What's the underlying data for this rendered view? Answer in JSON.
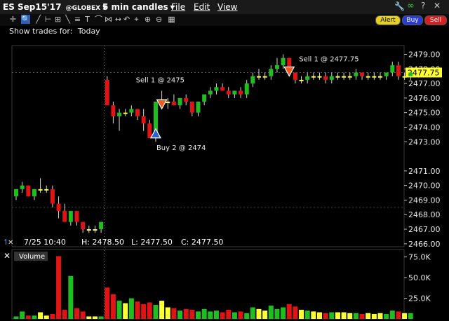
{
  "window": {
    "symbol": "ES Sep15'17",
    "exchange": "@GLOBEX",
    "interval": "5 min candles",
    "menus": [
      "File",
      "Edit",
      "View"
    ],
    "buttons": {
      "alert": "Alert",
      "buy": "Buy",
      "sell": "Sell"
    }
  },
  "toolbar": {
    "show_trades_label": "Show trades for:",
    "show_trades_value": "Today",
    "icons": [
      "crosshair-icon",
      "zoom-icon",
      "draw-tool-icon",
      "draw-tool-icon",
      "draw-tool-icon",
      "draw-tool-icon",
      "draw-tool-icon",
      "draw-tool-icon",
      "undo-icon",
      "draw-tool-icon",
      "draw-tool-icon",
      "zoom-in-icon",
      "zoom-out-icon",
      "draw-tool-icon",
      "layout-icon"
    ]
  },
  "colors": {
    "up": "#1fbe1f",
    "down": "#e01414",
    "neutral": "#ffff33",
    "price_box": "#ffff33",
    "background": "#000000"
  },
  "chart_data": {
    "type": "candlestick",
    "ylim": [
      2465.8,
      2479.6
    ],
    "yticks": [
      "2479.00",
      "2478.00",
      "2477.00",
      "2476.00",
      "2475.00",
      "2474.00",
      "2473.00",
      "2471.00",
      "2470.00",
      "2469.00",
      "2468.00",
      "2467.00",
      "2466.00"
    ],
    "ytick_values": [
      2479,
      2478,
      2477,
      2476,
      2475,
      2474,
      2473,
      2471,
      2470,
      2469,
      2468,
      2467,
      2466
    ],
    "last_price": "2477.75",
    "candles": [
      [
        2469.25,
        2469.75,
        2469.0,
        2469.75
      ],
      [
        2469.75,
        2470.25,
        2469.5,
        2470.0
      ],
      [
        2470.0,
        2470.0,
        2469.25,
        2469.25
      ],
      [
        2469.25,
        2469.75,
        2469.0,
        2469.75
      ],
      [
        2469.75,
        2470.5,
        2469.5,
        2469.75
      ],
      [
        2469.75,
        2470.0,
        2469.5,
        2469.75
      ],
      [
        2469.75,
        2470.0,
        2468.5,
        2468.75
      ],
      [
        2468.75,
        2469.25,
        2467.75,
        2468.25
      ],
      [
        2468.25,
        2468.75,
        2467.5,
        2467.5
      ],
      [
        2467.5,
        2468.25,
        2467.25,
        2468.25
      ],
      [
        2468.25,
        2468.25,
        2467.25,
        2467.5
      ],
      [
        2467.5,
        2467.5,
        2466.75,
        2467.0
      ],
      [
        2467.0,
        2467.25,
        2466.75,
        2467.0
      ],
      [
        2467.0,
        2467.25,
        2466.75,
        2467.0
      ],
      [
        2467.0,
        2467.5,
        2466.75,
        2467.5
      ],
      [
        2477.25,
        2477.5,
        2475.5,
        2475.5
      ],
      [
        2475.5,
        2475.75,
        2474.25,
        2474.75
      ],
      [
        2474.75,
        2475.25,
        2473.75,
        2475.0
      ],
      [
        2475.0,
        2475.25,
        2474.75,
        2475.0
      ],
      [
        2475.0,
        2475.5,
        2474.75,
        2475.25
      ],
      [
        2475.25,
        2475.25,
        2474.5,
        2474.75
      ],
      [
        2474.75,
        2475.25,
        2473.75,
        2474.25
      ],
      [
        2474.25,
        2474.5,
        2473.25,
        2473.25
      ],
      [
        2473.25,
        2475.75,
        2473.0,
        2475.75
      ],
      [
        2475.75,
        2476.5,
        2475.5,
        2475.75
      ],
      [
        2475.75,
        2476.0,
        2475.25,
        2475.75
      ],
      [
        2475.75,
        2476.25,
        2475.5,
        2475.5
      ],
      [
        2475.5,
        2476.0,
        2475.25,
        2476.0
      ],
      [
        2476.0,
        2476.25,
        2475.5,
        2475.75
      ],
      [
        2475.75,
        2475.75,
        2474.75,
        2475.0
      ],
      [
        2475.0,
        2475.75,
        2474.75,
        2475.75
      ],
      [
        2475.75,
        2476.25,
        2475.5,
        2476.25
      ],
      [
        2476.25,
        2476.75,
        2476.0,
        2476.5
      ],
      [
        2476.5,
        2477.0,
        2476.25,
        2476.75
      ],
      [
        2476.75,
        2477.0,
        2476.5,
        2476.5
      ],
      [
        2476.5,
        2476.75,
        2476.0,
        2476.25
      ],
      [
        2476.25,
        2476.5,
        2476.0,
        2476.5
      ],
      [
        2476.5,
        2476.75,
        2476.0,
        2476.25
      ],
      [
        2476.25,
        2477.25,
        2476.0,
        2477.0
      ],
      [
        2477.0,
        2477.75,
        2476.75,
        2477.5
      ],
      [
        2477.5,
        2478.0,
        2477.25,
        2477.5
      ],
      [
        2477.5,
        2477.75,
        2477.25,
        2477.5
      ],
      [
        2477.5,
        2478.25,
        2477.25,
        2478.0
      ],
      [
        2478.0,
        2478.75,
        2477.75,
        2478.25
      ],
      [
        2478.25,
        2479.0,
        2478.0,
        2478.75
      ],
      [
        2478.75,
        2478.75,
        2477.75,
        2477.75
      ],
      [
        2477.75,
        2477.75,
        2477.0,
        2477.25
      ],
      [
        2477.25,
        2477.5,
        2477.0,
        2477.25
      ],
      [
        2477.25,
        2477.75,
        2477.0,
        2477.5
      ],
      [
        2477.5,
        2477.75,
        2477.25,
        2477.5
      ],
      [
        2477.5,
        2477.75,
        2477.25,
        2477.5
      ],
      [
        2477.5,
        2477.75,
        2477.0,
        2477.25
      ],
      [
        2477.25,
        2477.75,
        2477.0,
        2477.5
      ],
      [
        2477.5,
        2477.75,
        2477.25,
        2477.5
      ],
      [
        2477.5,
        2477.75,
        2477.25,
        2477.5
      ],
      [
        2477.5,
        2477.75,
        2477.25,
        2477.5
      ],
      [
        2477.5,
        2478.0,
        2477.25,
        2477.75
      ],
      [
        2477.75,
        2477.75,
        2477.25,
        2477.5
      ],
      [
        2477.5,
        2477.75,
        2477.25,
        2477.5
      ],
      [
        2477.5,
        2477.75,
        2477.25,
        2477.5
      ],
      [
        2477.5,
        2477.75,
        2477.25,
        2477.5
      ],
      [
        2477.5,
        2477.75,
        2477.25,
        2477.75
      ],
      [
        2477.75,
        2478.5,
        2477.5,
        2478.25
      ],
      [
        2478.25,
        2478.5,
        2477.25,
        2477.5
      ],
      [
        2477.5,
        2477.75,
        2477.25,
        2477.5
      ],
      [
        2477.5,
        2477.75,
        2477.25,
        2477.75
      ]
    ],
    "session_break_index": 15,
    "trade_markers": [
      {
        "type": "sell",
        "label": "Sell 1 @ 2475",
        "index": 24,
        "price": 2475.5
      },
      {
        "type": "buy",
        "label": "Buy 2 @ 2474",
        "index": 23,
        "price": 2473.6
      },
      {
        "type": "sell",
        "label": "Sell 1 @ 2477.75",
        "index": 45,
        "price": 2477.75
      }
    ],
    "info_bar": {
      "date_time": "7/25 10:40",
      "high": "H: 2478.50",
      "low": "L: 2477.50",
      "close": "C: 2477.50"
    },
    "volume": {
      "label": "Volume",
      "yticks": [
        "75.0K",
        "50.0K",
        "25.0K"
      ],
      "ytick_values": [
        75000,
        50000,
        25000
      ],
      "ylim": [
        0,
        84000
      ],
      "values": [
        3000,
        9000,
        4000,
        4000,
        8000,
        4000,
        6000,
        76000,
        11000,
        52000,
        13000,
        9000,
        3000,
        3000,
        3000,
        38000,
        30000,
        22000,
        19000,
        25000,
        21000,
        18000,
        20000,
        17000,
        22000,
        14000,
        13000,
        10000,
        12000,
        11000,
        9000,
        12000,
        9000,
        10000,
        8000,
        11000,
        8000,
        9000,
        7000,
        14000,
        12000,
        10000,
        16000,
        12000,
        14000,
        18000,
        15000,
        11000,
        10000,
        9000,
        8000,
        7000,
        8000,
        8000,
        8000,
        7000,
        7000,
        6000,
        7000,
        6000,
        7000,
        6000,
        10000,
        9000,
        7000,
        7000
      ]
    }
  }
}
